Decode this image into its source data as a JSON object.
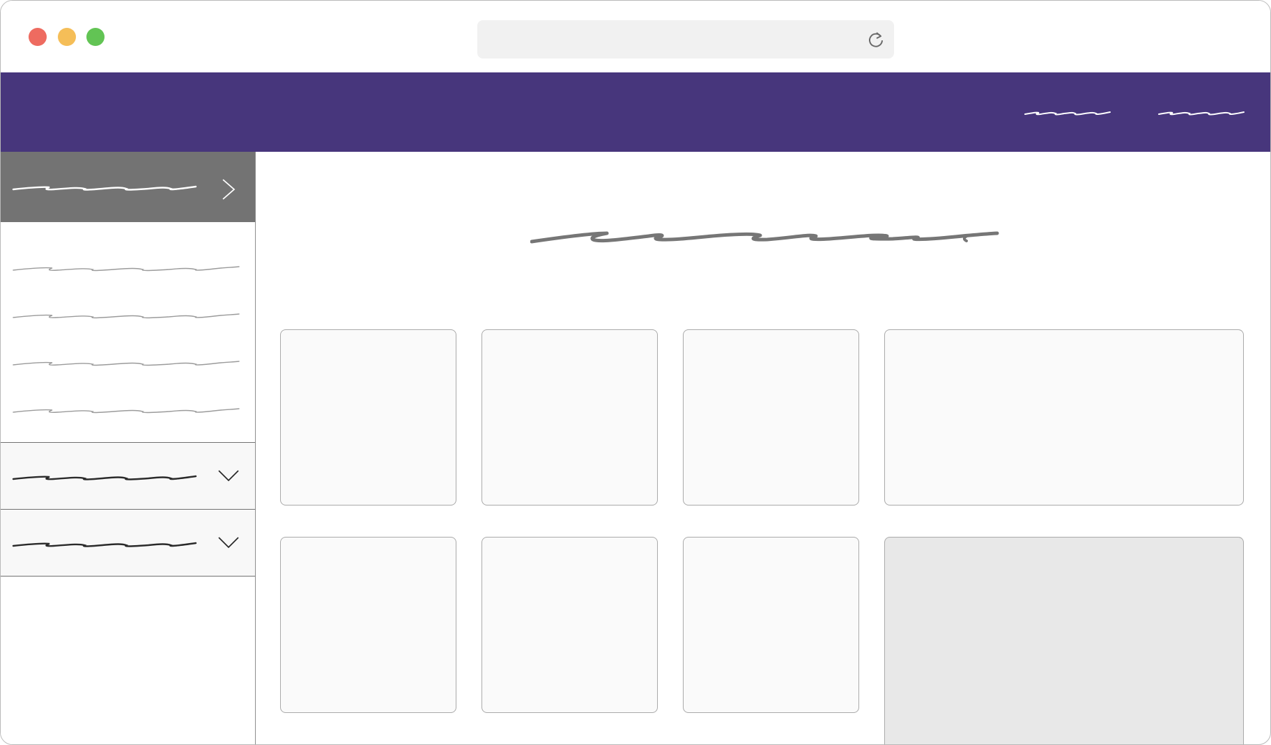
{
  "window": {
    "traffic_lights": [
      "close",
      "minimize",
      "zoom"
    ],
    "address_bar": {
      "value": "",
      "reload_icon": "reload-icon"
    }
  },
  "colors": {
    "header_bg": "#47367c",
    "sidebar_active_bg": "#737373",
    "accordion_bg": "#f8f8f8",
    "card_bg": "#fafafa",
    "card_highlight_bg": "#e8e8e8"
  },
  "header": {
    "nav_links": [
      {
        "label": "",
        "rendered_as": "scribble"
      },
      {
        "label": "",
        "rendered_as": "scribble"
      }
    ]
  },
  "sidebar": {
    "active_section": {
      "label": "",
      "rendered_as": "scribble",
      "icon": "chevron-right-icon"
    },
    "sub_items": [
      {
        "label": "",
        "rendered_as": "scribble"
      },
      {
        "label": "",
        "rendered_as": "scribble"
      },
      {
        "label": "",
        "rendered_as": "scribble"
      },
      {
        "label": "",
        "rendered_as": "scribble"
      }
    ],
    "collapsed_sections": [
      {
        "label": "",
        "rendered_as": "scribble",
        "icon": "chevron-down-icon"
      },
      {
        "label": "",
        "rendered_as": "scribble",
        "icon": "chevron-down-icon"
      }
    ]
  },
  "main": {
    "title": {
      "label": "",
      "rendered_as": "scribble"
    },
    "cards": [
      {
        "row": 1,
        "col": 1
      },
      {
        "row": 1,
        "col": 2
      },
      {
        "row": 1,
        "col": 3
      },
      {
        "row": 1,
        "col": 4,
        "wide": true
      },
      {
        "row": 2,
        "col": 1
      },
      {
        "row": 2,
        "col": 2
      },
      {
        "row": 2,
        "col": 3
      },
      {
        "row": 2,
        "col": 4,
        "wide": true,
        "highlighted": true
      }
    ]
  }
}
